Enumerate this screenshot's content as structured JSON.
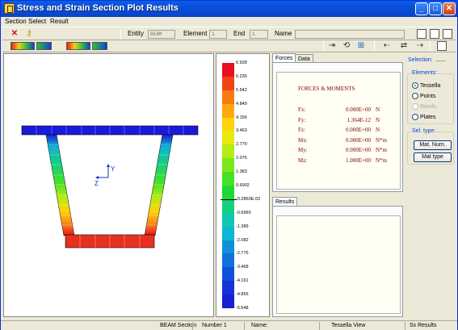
{
  "window": {
    "title": "Stress and Strain Section Plot Results",
    "buttons": [
      "_",
      "□",
      "✕"
    ]
  },
  "menu": [
    "Section",
    "Select",
    "Result"
  ],
  "toolbar": {
    "entity_label": "Entity",
    "entity_value": "BEAM",
    "element_label": "Element",
    "element_value": "1",
    "end_label": "End",
    "end_value": "1",
    "name_label": "Name",
    "name_value": ""
  },
  "viewport": {
    "axis_y": "Y",
    "axis_z": "Z",
    "colors": {
      "top": "#1a1adb",
      "bottom": "#e83020"
    }
  },
  "scale": {
    "labels": [
      "6.928",
      "6.235",
      "5.542",
      "4.849",
      "4.156",
      "3.463",
      "2.770",
      "2.076",
      "1.383",
      "0.6902",
      "-0.2860E-02",
      "-0.6960",
      "-1.389",
      "-2.082",
      "-2.775",
      "-3.468",
      "-4.161",
      "-4.855",
      "-5.548"
    ],
    "colors": [
      "#e8101c",
      "#f04418",
      "#f87a14",
      "#ffa810",
      "#ffd20c",
      "#e8e810",
      "#b4ec14",
      "#7ce81c",
      "#48e024",
      "#1cd838",
      "#14d07c",
      "#10c8b0",
      "#10b4d4",
      "#1090d8",
      "#1070dc",
      "#1050dc",
      "#1434d8",
      "#1820d0"
    ]
  },
  "forces": {
    "tabs": [
      "Forces",
      "Data"
    ],
    "title": "FORCES & MOMENTS",
    "rows": [
      {
        "key": "Fx:",
        "value": "0.000E+00",
        "unit": "N"
      },
      {
        "key": "Fy:",
        "value": "1.364E-12",
        "unit": "N"
      },
      {
        "key": "Fz:",
        "value": "0.000E+00",
        "unit": "N"
      },
      {
        "key": "Mx:",
        "value": "0.000E+00",
        "unit": "N*m"
      },
      {
        "key": "My:",
        "value": "0.000E+00",
        "unit": "N*m"
      },
      {
        "key": "Mz:",
        "value": "1.000E+00",
        "unit": "N*m"
      }
    ]
  },
  "results": {
    "tab": "Results"
  },
  "selection": {
    "title": "Selection:",
    "elements_title": "Elements:",
    "options": [
      "Tessella",
      "Points",
      "Reinfs.",
      "Plates"
    ],
    "seltype_title": "Sel. type:",
    "mat_num": "Mat. Num.",
    "mat_type": "Mat type"
  },
  "status": [
    "BEAM Section",
    "Number 1",
    "Name:",
    "Tessella View",
    "Sx Results"
  ]
}
